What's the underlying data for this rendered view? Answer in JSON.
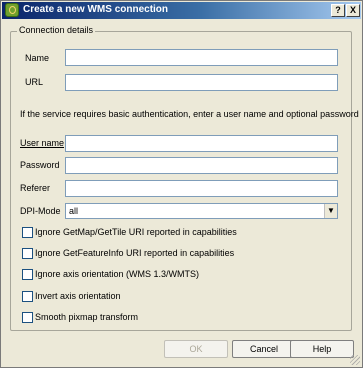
{
  "window": {
    "title": "Create a new WMS connection",
    "help_btn": "?",
    "close_btn": "X"
  },
  "group": {
    "title": "Connection details",
    "auth_note": "If the service requires basic authentication, enter a user name and optional password"
  },
  "fields": {
    "name_label": "Name",
    "name_value": "",
    "url_label": "URL",
    "url_value": "",
    "username_label": "User name",
    "username_value": "",
    "password_label": "Password",
    "password_value": "",
    "referer_label": "Referer",
    "referer_value": ""
  },
  "dpi": {
    "label": "DPI-Mode",
    "value": "all",
    "arrow": "▼"
  },
  "checkboxes": [
    {
      "label": "Ignore GetMap/GetTile URI reported in capabilities",
      "checked": false
    },
    {
      "label": "Ignore GetFeatureInfo URI reported in capabilities",
      "checked": false
    },
    {
      "label": "Ignore axis orientation (WMS 1.3/WMTS)",
      "checked": false
    },
    {
      "label": "Invert axis orientation",
      "checked": false
    },
    {
      "label": "Smooth pixmap transform",
      "checked": false
    }
  ],
  "buttons": {
    "ok": "OK",
    "cancel": "Cancel",
    "help": "Help"
  }
}
